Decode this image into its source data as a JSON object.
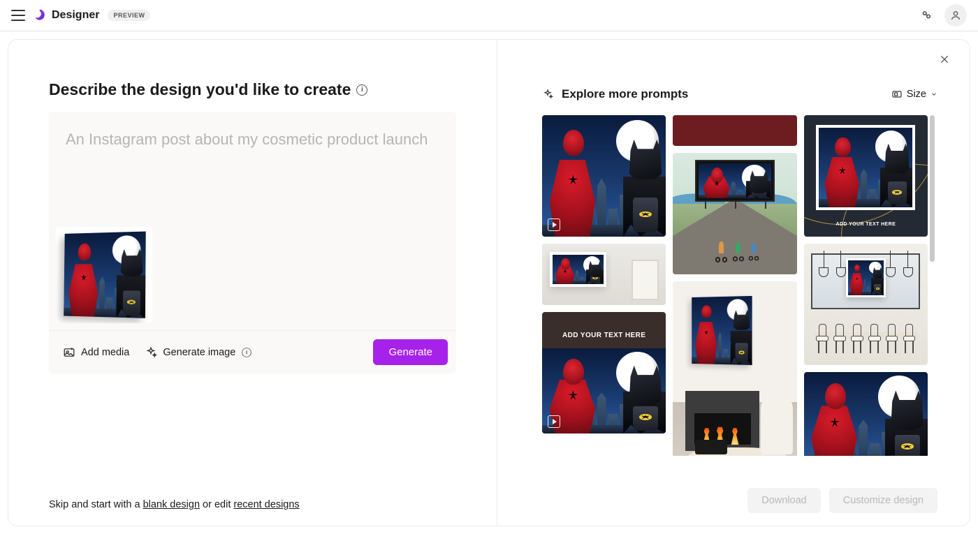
{
  "header": {
    "app_name": "Designer",
    "badge": "PREVIEW"
  },
  "left": {
    "heading": "Describe the design you'd like to create",
    "placeholder": "An Instagram post about my cosmetic product launch",
    "add_media": "Add media",
    "generate_image": "Generate image",
    "generate_btn": "Generate",
    "skip_prefix": "Skip and start with a ",
    "skip_blank": "blank design",
    "skip_mid": " or edit ",
    "skip_recent": "recent designs"
  },
  "right": {
    "explore": "Explore more prompts",
    "size_label": "Size",
    "download": "Download",
    "customize": "Customize design",
    "tiles": {
      "t2_caption": "ADD YOUR TEXT HERE",
      "t3_caption": "ADD YOUR TEXT HERE"
    }
  }
}
